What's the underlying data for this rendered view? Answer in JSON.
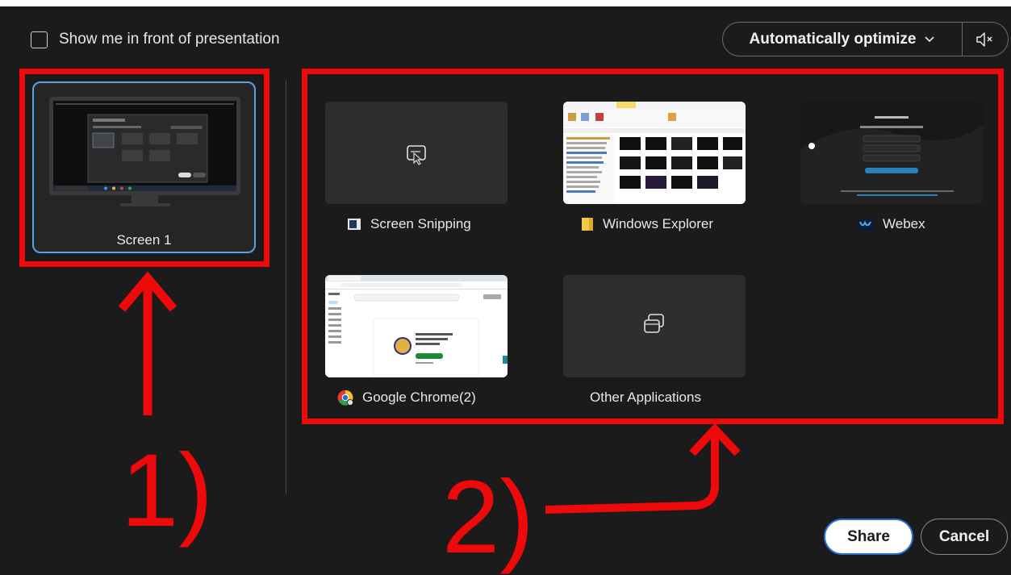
{
  "header": {
    "show_me_label": "Show me in front of presentation",
    "optimize_label": "Automatically optimize"
  },
  "screens": [
    {
      "label": "Screen 1"
    }
  ],
  "apps": [
    {
      "label": "Screen Snipping",
      "icon": "screen-snipping-icon"
    },
    {
      "label": "Windows Explorer",
      "icon": "folder-icon"
    },
    {
      "label": "Webex",
      "icon": "webex-icon"
    },
    {
      "label": "Google Chrome(2)",
      "icon": "chrome-icon"
    },
    {
      "label": "Other Applications",
      "icon": "other-applications-icon"
    }
  ],
  "annotations": {
    "first": "1)",
    "second": "2)"
  },
  "footer": {
    "share_label": "Share",
    "cancel_label": "Cancel"
  },
  "colors": {
    "background": "#1b1b1b",
    "annotation": "#ee0a0a",
    "selected_border": "#5aa0e6"
  }
}
